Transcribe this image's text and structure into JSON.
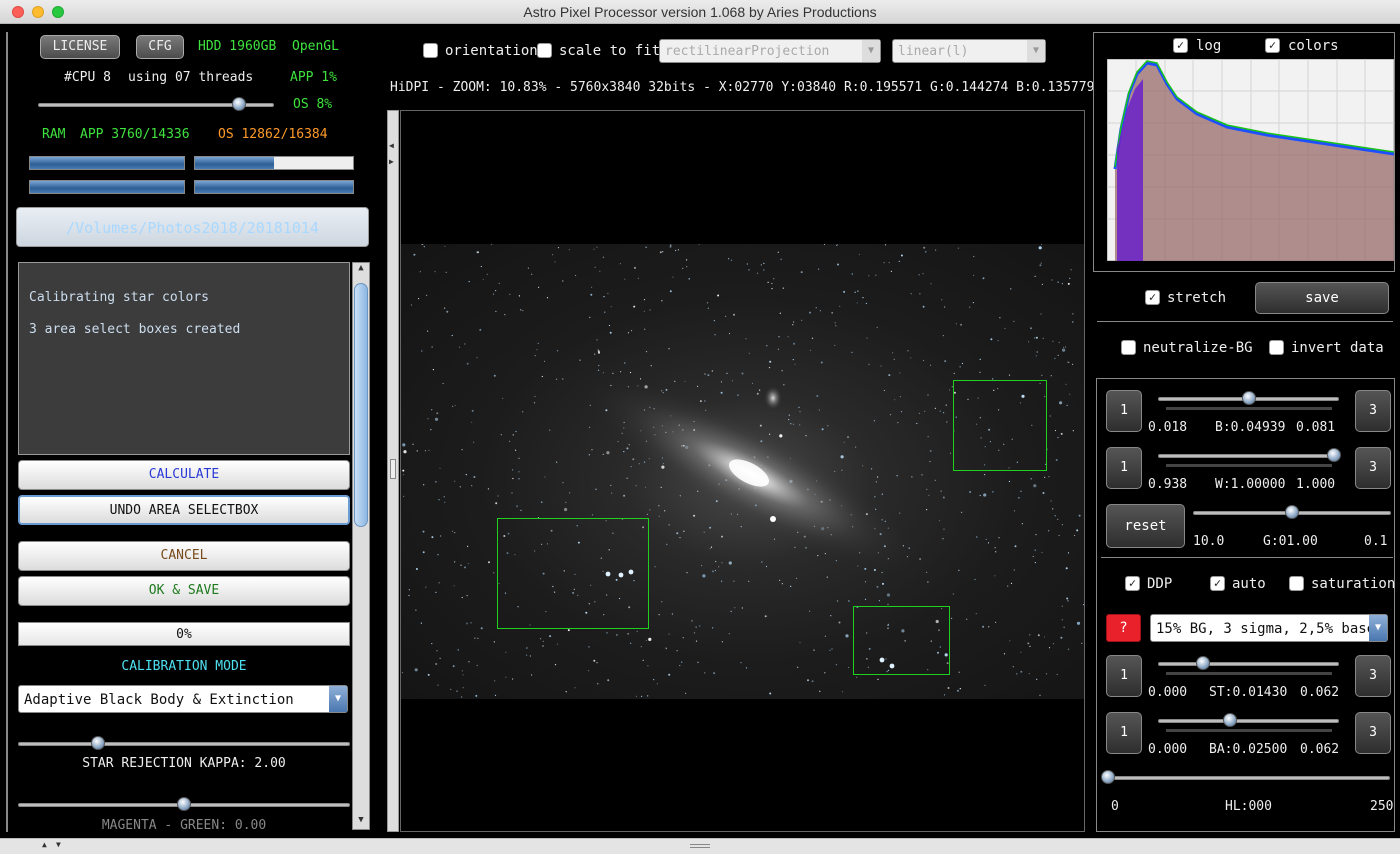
{
  "window": {
    "title": "Astro Pixel Processor version 1.068 by Aries Productions"
  },
  "left": {
    "license_label": "LICENSE",
    "cfg_label": "CFG",
    "hdd": "HDD 1960GB",
    "opengl": "OpenGL",
    "cpu": "#CPU 8",
    "threads": "using 07 threads",
    "app_pct": "APP 1%",
    "os_pct": "OS 8%",
    "ram_label": "RAM",
    "ram_app": "APP 3760/14336",
    "ram_os": "OS 12862/16384",
    "path": "/Volumes/Photos2018/20181014",
    "console_lines": [
      "Calibrating star colors",
      "3 area select boxes created"
    ],
    "calculate": "CALCULATE",
    "undo": "UNDO AREA SELECTBOX",
    "cancel": "CANCEL",
    "ok_save": "OK & SAVE",
    "progress": "0%",
    "calibration_mode_label": "CALIBRATION MODE",
    "calibration_mode_value": "Adaptive Black Body & Extinction",
    "kappa": "STAR REJECTION KAPPA: 2.00",
    "magenta_green": "MAGENTA - GREEN: 0.00",
    "cpu_slider_value": 0.85,
    "progress_bars": [
      1.0,
      0.5,
      1.0,
      1.0
    ],
    "kappa_slider_value": 0.24,
    "mg_slider_value": 0.5
  },
  "toolbar": {
    "orientation_label": "orientation",
    "scale_label": "scale to fit",
    "projection": "rectilinearProjection",
    "stretch_mode": "linear(l)",
    "status": "HiDPI - ZOOM: 10.83% - 5760x3840 32bits - X:02770 Y:03840 R:0.195571 G:0.144274 B:0.135779"
  },
  "right": {
    "log_label": "log",
    "colors_label": "colors",
    "stretch_label": "stretch",
    "save_label": "save",
    "neutralize_label": "neutralize-BG",
    "invert_label": "invert data",
    "b_row": {
      "left_btn": "1",
      "right_btn": "3",
      "min": "0.018",
      "value": "B:0.04939",
      "max": "0.081",
      "pos": 0.5
    },
    "w_row": {
      "left_btn": "1",
      "right_btn": "3",
      "min": "0.938",
      "value": "W:1.00000",
      "max": "1.000",
      "pos": 0.97
    },
    "g_row": {
      "reset": "reset",
      "min": "10.0",
      "value": "G:01.00",
      "max": "0.1",
      "pos": 0.5
    },
    "ddp_label": "DDP",
    "auto_label": "auto",
    "saturation_label": "saturation",
    "help_label": "?",
    "preset": "15% BG, 3 sigma, 2,5% base",
    "st_row": {
      "left_btn": "1",
      "right_btn": "3",
      "min": "0.000",
      "value": "ST:0.01430",
      "max": "0.062",
      "pos": 0.25
    },
    "ba_row": {
      "left_btn": "1",
      "right_btn": "3",
      "min": "0.000",
      "value": "BA:0.02500",
      "max": "0.062",
      "pos": 0.4
    },
    "hl_row": {
      "min": "0",
      "value": "HL:000",
      "max": "250",
      "pos": 0.0
    }
  },
  "colors": {
    "green_text": "#3ee33e",
    "orange_text": "#ff9a2a",
    "cyan_text": "#4fe0f0",
    "selection_box": "#1fd01f",
    "help_button": "#e8212a"
  }
}
